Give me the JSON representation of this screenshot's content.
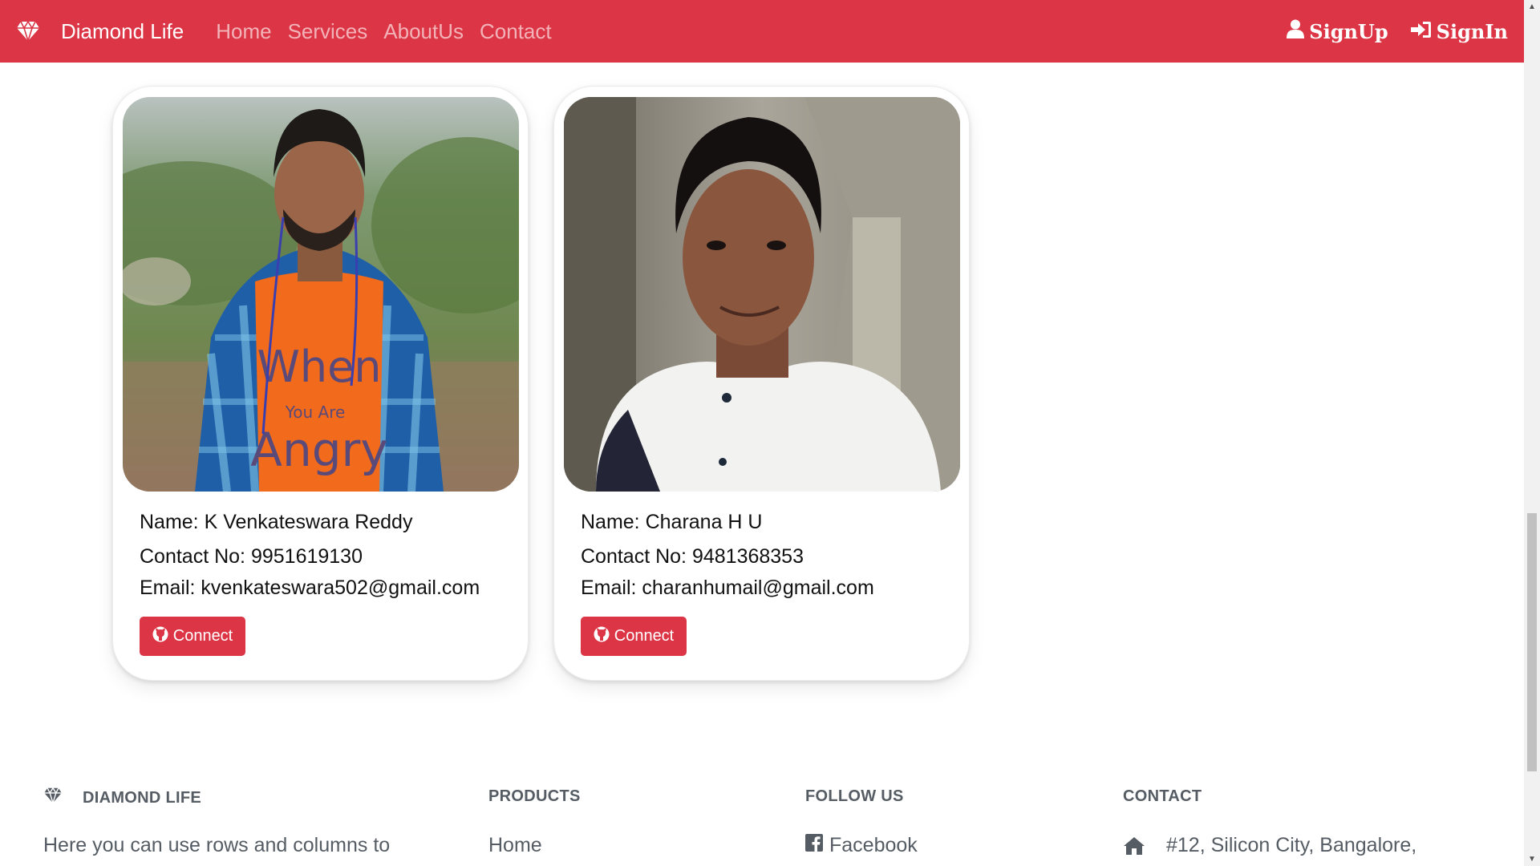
{
  "navbar": {
    "brand": "Diamond Life",
    "links": [
      "Home",
      "Services",
      "AboutUs",
      "Contact"
    ],
    "signup_label": "SignUp",
    "signin_label": "SignIn",
    "background": "#dc3545"
  },
  "cards": [
    {
      "name_line": "Name: K Venkateswara Reddy",
      "contact_line": "Contact No: 9951619130",
      "email_line": "Email: kvenkateswara502@gmail.com",
      "button_label": "Connect",
      "photo_tshirt_text": [
        "When",
        "You Are",
        "Angry"
      ]
    },
    {
      "name_line": "Name: Charana H U",
      "contact_line": "Contact No: 9481368353",
      "email_line": "Email: charanhumail@gmail.com",
      "button_label": "Connect"
    }
  ],
  "footer": {
    "brand_title": "DIAMOND LIFE",
    "brand_text": "Here you can use rows and columns to",
    "products_title": "PRODUCTS",
    "products_first": "Home",
    "follow_title": "FOLLOW US",
    "follow_first": "Facebook",
    "contact_title": "CONTACT",
    "contact_first": "#12, Silicon City, Bangalore,"
  },
  "icons": {
    "brand": "gem-icon",
    "signup": "user-icon",
    "signin": "sign-in-icon",
    "connect": "github-icon",
    "follow": "facebook-icon",
    "contact": "home-icon"
  },
  "colors": {
    "accent": "#dc3545",
    "footer_text": "#555c63"
  }
}
